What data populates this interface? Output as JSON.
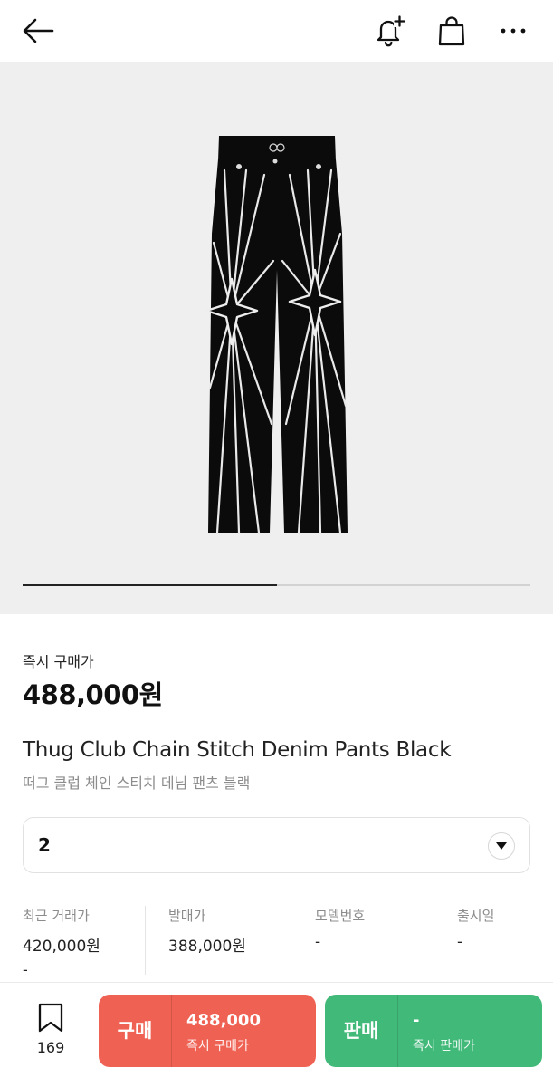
{
  "icons": {
    "back": "arrow-left-icon",
    "notify": "bell-plus-icon",
    "cart": "shopping-bag-icon",
    "more": "more-dots-icon",
    "select": "triangle-down-icon",
    "wishlist": "bookmark-icon"
  },
  "image": {
    "slide_progress": 0.5
  },
  "product": {
    "instant_price_label": "즉시 구매가",
    "instant_price": "488,000원",
    "name_en": "Thug Club Chain Stitch Denim Pants Black",
    "name_ko": "떠그 클럽 체인 스티치 데님 팬츠 블랙"
  },
  "size_select": {
    "value": "2"
  },
  "stats": [
    {
      "label": "최근 거래가",
      "value": "420,000원",
      "sub": "-"
    },
    {
      "label": "발매가",
      "value": "388,000원",
      "sub": ""
    },
    {
      "label": "모델번호",
      "value": "-",
      "sub": ""
    },
    {
      "label": "출시일",
      "value": "-",
      "sub": ""
    }
  ],
  "bottom": {
    "wish_count": "169",
    "buy": {
      "label": "구매",
      "price": "488,000",
      "sub": "즉시 구매가"
    },
    "sell": {
      "label": "판매",
      "price": "-",
      "sub": "즉시 판매가"
    }
  },
  "colors": {
    "buy": "#ef6253",
    "sell": "#41b979",
    "image_bg": "#efefef"
  }
}
